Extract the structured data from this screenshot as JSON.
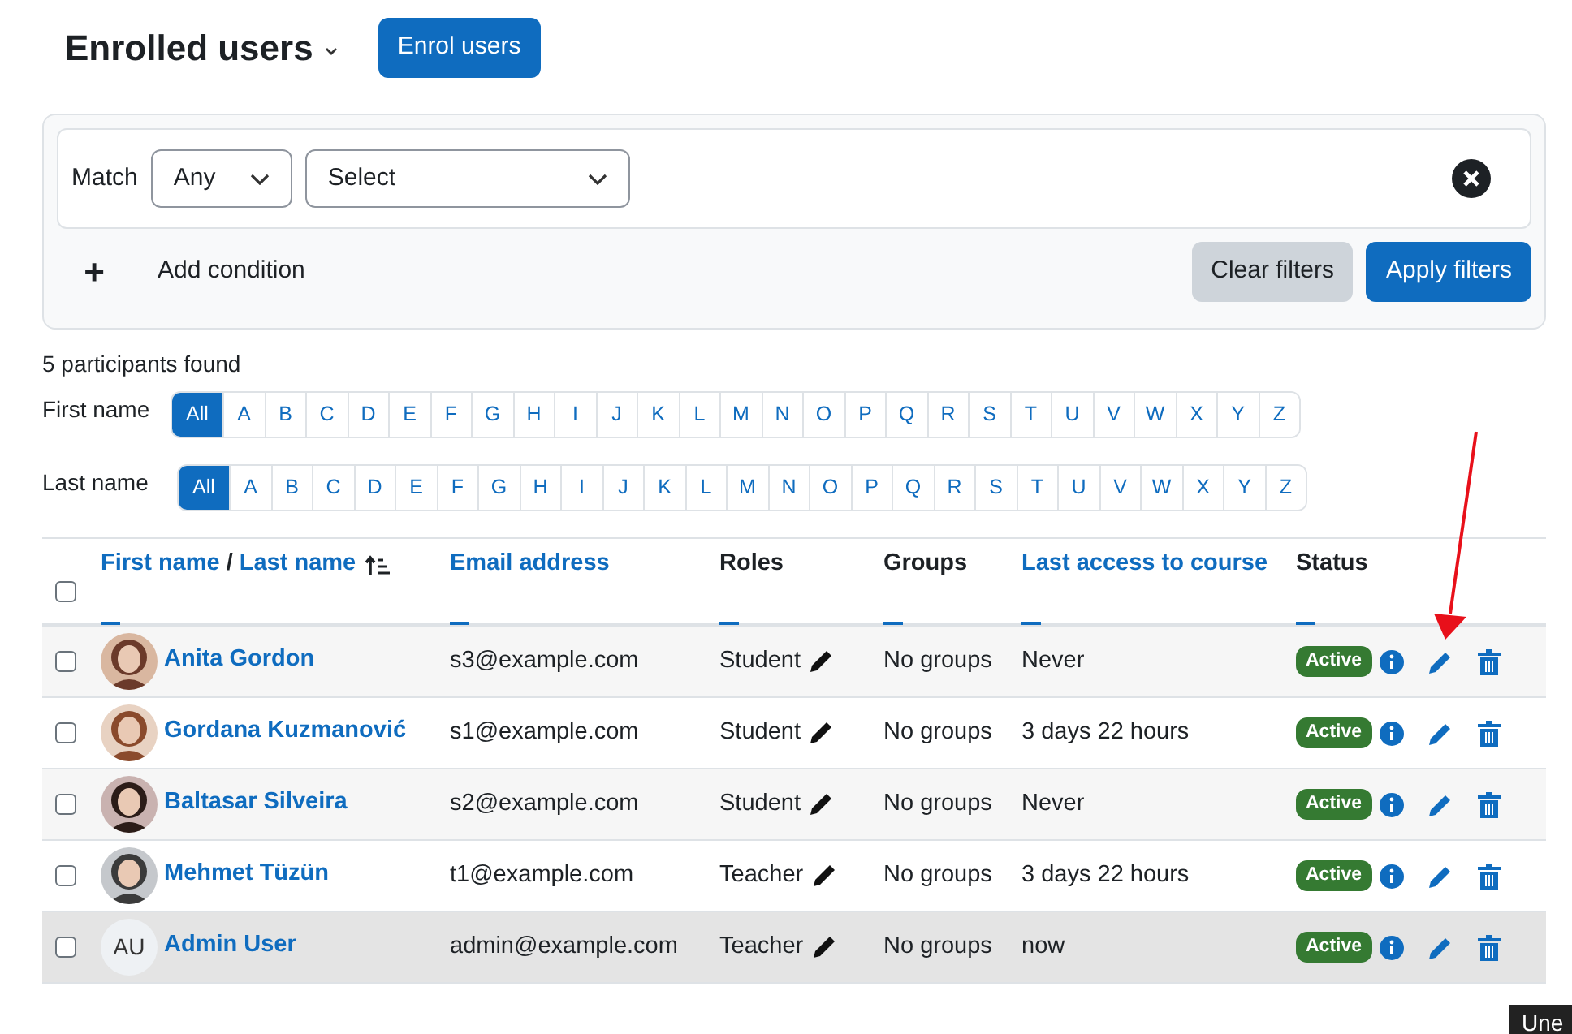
{
  "header": {
    "title": "Enrolled users",
    "button": "Enrol users"
  },
  "filter": {
    "match_label": "Match",
    "match_value": "Any",
    "condition_placeholder": "Select",
    "add_icon": "+",
    "add_condition": "Add condition",
    "buttons": [
      {
        "label": "Clear filters",
        "kind": "secondary"
      },
      {
        "label": "Apply filters",
        "kind": "primary"
      }
    ]
  },
  "participants_found": "5 participants found",
  "initials_bars": [
    {
      "label": "First name",
      "letters": [
        {
          "text": "All",
          "selected": true
        },
        {
          "text": "A",
          "selected": false
        },
        {
          "text": "B",
          "selected": false
        },
        {
          "text": "C",
          "selected": false
        },
        {
          "text": "D",
          "selected": false
        },
        {
          "text": "E",
          "selected": false
        },
        {
          "text": "F",
          "selected": false
        },
        {
          "text": "G",
          "selected": false
        },
        {
          "text": "H",
          "selected": false
        },
        {
          "text": "I",
          "selected": false
        },
        {
          "text": "J",
          "selected": false
        },
        {
          "text": "K",
          "selected": false
        },
        {
          "text": "L",
          "selected": false
        },
        {
          "text": "M",
          "selected": false
        },
        {
          "text": "N",
          "selected": false
        },
        {
          "text": "O",
          "selected": false
        },
        {
          "text": "P",
          "selected": false
        },
        {
          "text": "Q",
          "selected": false
        },
        {
          "text": "R",
          "selected": false
        },
        {
          "text": "S",
          "selected": false
        },
        {
          "text": "T",
          "selected": false
        },
        {
          "text": "U",
          "selected": false
        },
        {
          "text": "V",
          "selected": false
        },
        {
          "text": "W",
          "selected": false
        },
        {
          "text": "X",
          "selected": false
        },
        {
          "text": "Y",
          "selected": false
        },
        {
          "text": "Z",
          "selected": false
        }
      ]
    },
    {
      "label": "Last name",
      "letters": [
        {
          "text": "All",
          "selected": true
        },
        {
          "text": "A",
          "selected": false
        },
        {
          "text": "B",
          "selected": false
        },
        {
          "text": "C",
          "selected": false
        },
        {
          "text": "D",
          "selected": false
        },
        {
          "text": "E",
          "selected": false
        },
        {
          "text": "F",
          "selected": false
        },
        {
          "text": "G",
          "selected": false
        },
        {
          "text": "H",
          "selected": false
        },
        {
          "text": "I",
          "selected": false
        },
        {
          "text": "J",
          "selected": false
        },
        {
          "text": "K",
          "selected": false
        },
        {
          "text": "L",
          "selected": false
        },
        {
          "text": "M",
          "selected": false
        },
        {
          "text": "N",
          "selected": false
        },
        {
          "text": "O",
          "selected": false
        },
        {
          "text": "P",
          "selected": false
        },
        {
          "text": "Q",
          "selected": false
        },
        {
          "text": "R",
          "selected": false
        },
        {
          "text": "S",
          "selected": false
        },
        {
          "text": "T",
          "selected": false
        },
        {
          "text": "U",
          "selected": false
        },
        {
          "text": "V",
          "selected": false
        },
        {
          "text": "W",
          "selected": false
        },
        {
          "text": "X",
          "selected": false
        },
        {
          "text": "Y",
          "selected": false
        },
        {
          "text": "Z",
          "selected": false
        }
      ]
    }
  ],
  "table": {
    "select_all_checked": false,
    "columns": [
      {
        "labels": [
          "First name",
          "Last name"
        ],
        "separator": "/",
        "sortable": true,
        "sorted": true
      },
      {
        "labels": [
          "Email address"
        ],
        "sortable": true,
        "sorted": false
      },
      {
        "labels": [
          "Roles"
        ],
        "sortable": false,
        "sorted": false
      },
      {
        "labels": [
          "Groups"
        ],
        "sortable": false,
        "sorted": false
      },
      {
        "labels": [
          "Last access to course"
        ],
        "sortable": true,
        "sorted": false
      },
      {
        "labels": [
          "Status"
        ],
        "sortable": false,
        "sorted": false
      }
    ],
    "rows": [
      {
        "checked": false,
        "highlighted": false,
        "name": "Anita Gordon",
        "email": "s3@example.com",
        "role": "Student",
        "groups": "No groups",
        "last_access": "Never",
        "status": "Active"
      },
      {
        "checked": false,
        "highlighted": false,
        "name": "Gordana Kuzmanović",
        "email": "s1@example.com",
        "role": "Student",
        "groups": "No groups",
        "last_access": "3 days 22 hours",
        "status": "Active"
      },
      {
        "checked": false,
        "highlighted": false,
        "name": "Baltasar Silveira",
        "email": "s2@example.com",
        "role": "Student",
        "groups": "No groups",
        "last_access": "Never",
        "status": "Active"
      },
      {
        "checked": false,
        "highlighted": false,
        "name": "Mehmet Tüzün",
        "email": "t1@example.com",
        "role": "Teacher",
        "groups": "No groups",
        "last_access": "3 days 22 hours",
        "status": "Active"
      },
      {
        "checked": false,
        "highlighted": true,
        "avatar": {
          "kind": "initials",
          "text": "AU"
        },
        "name": "Admin User",
        "email": "admin@example.com",
        "role": "Teacher",
        "groups": "No groups",
        "last_access": "now",
        "status": "Active"
      }
    ]
  },
  "tooltip": "Une"
}
